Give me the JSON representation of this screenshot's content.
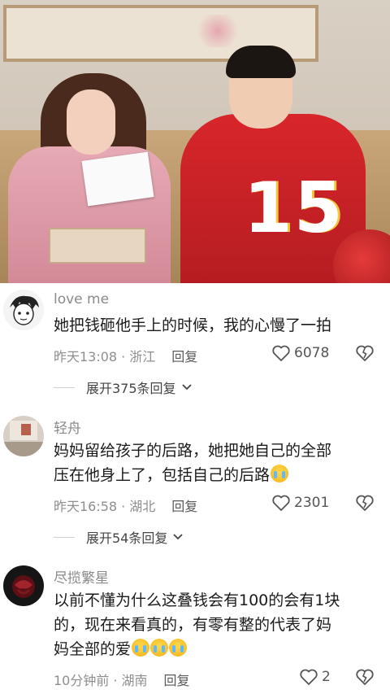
{
  "video": {
    "jersey_number": "15"
  },
  "comments": [
    {
      "username": "love me",
      "text": "她把钱砸他手上的时候，我的心慢了一拍",
      "time": "昨天13:08",
      "location": "浙江",
      "reply_label": "回复",
      "likes": "6078",
      "expand_label": "展开375条回复"
    },
    {
      "username": "轻舟",
      "text_line1": "妈妈留给孩子的后路，她把她自己的全部",
      "text_line2": "压在他身上了，包括自己的后路",
      "emoji_count": 1,
      "time": "昨天16:58",
      "location": "湖北",
      "reply_label": "回复",
      "likes": "2301",
      "expand_label": "展开54条回复"
    },
    {
      "username": "尽揽繁星",
      "text_line1": "以前不懂为什么这叠钱会有100的会有1块",
      "text_line2": "的，现在来看真的，有零有整的代表了妈",
      "text_line3": "妈全部的爱",
      "emoji_count": 3,
      "time": "10分钟前",
      "location": "湖南",
      "reply_label": "回复",
      "likes": "2"
    }
  ],
  "icons": {
    "like": "heart-outline-icon",
    "dislike": "broken-heart-icon",
    "expand": "chevron-down-icon"
  },
  "colors": {
    "panel_bg": "#ffffff",
    "meta_text": "#8e8e8e",
    "jersey_red": "#d8262b"
  }
}
